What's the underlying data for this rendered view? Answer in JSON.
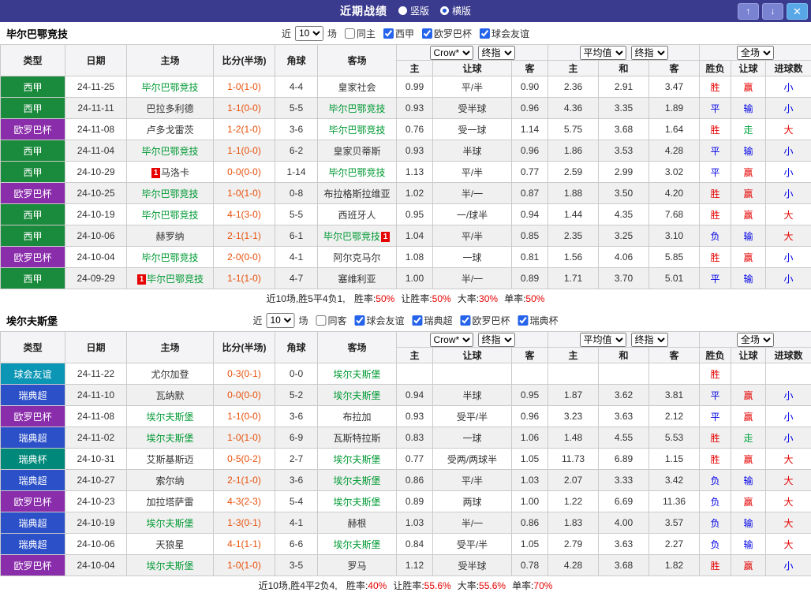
{
  "topbar": {
    "title": "近期战绩",
    "radios": [
      {
        "label": "竖版",
        "selected": false
      },
      {
        "label": "横版",
        "selected": true
      }
    ],
    "up_icon": "↑",
    "down_icon": "↓",
    "close_icon": "✕"
  },
  "colors": {
    "topbar_bg": "#3a3a8e",
    "focus_team": "#009933",
    "score": "#e8500a",
    "summary_value": "#e60000",
    "league_colors": {
      "西甲": "#1a8a3c",
      "欧罗巴杯": "#8a2dab",
      "球会友谊": "#0a96b4",
      "瑞典超": "#2b50c8",
      "瑞典杯": "#00897b"
    },
    "result_colors": {
      "胜": "#e60000",
      "平": "#0000e6",
      "负": "#0000e6",
      "赢": "#e60000",
      "输": "#0000e6",
      "走": "#00a33e",
      "大": "#e60000",
      "小": "#0000e6"
    }
  },
  "header": {
    "main_cols": [
      "类型",
      "日期",
      "主场",
      "比分(半场)",
      "角球",
      "客场"
    ],
    "select_groups": [
      [
        {
          "name": "bookmaker-select",
          "label": "Crow*"
        },
        {
          "name": "odds-time-select",
          "label": "终指"
        }
      ],
      [
        {
          "name": "average-select",
          "label": "平均值"
        },
        {
          "name": "avg-odds-time-select",
          "label": "终指"
        }
      ],
      [
        {
          "name": "match-scope-select",
          "label": "全场"
        }
      ]
    ],
    "sub_cols": [
      "主",
      "让球",
      "客",
      "主",
      "和",
      "客",
      "胜负",
      "让球",
      "进球数"
    ]
  },
  "tables": [
    {
      "team": "毕尔巴鄂竞技",
      "filter": {
        "near_label": "近",
        "count": "10",
        "games_label": "场",
        "same": {
          "label": "同主",
          "checked": false
        },
        "leagues": [
          {
            "label": "西甲",
            "checked": true
          },
          {
            "label": "欧罗巴杯",
            "checked": true
          },
          {
            "label": "球会友谊",
            "checked": true
          }
        ]
      },
      "rows": [
        {
          "type": "西甲",
          "date": "24-11-25",
          "home": {
            "name": "毕尔巴鄂竞技",
            "focus": true
          },
          "score": "1-0(1-0)",
          "corner": "4-4",
          "away": {
            "name": "皇家社会"
          },
          "odds": [
            "0.99",
            "平/半",
            "0.90"
          ],
          "avg": [
            "2.36",
            "2.91",
            "3.47"
          ],
          "res": [
            "胜",
            "赢",
            "小"
          ]
        },
        {
          "type": "西甲",
          "date": "24-11-11",
          "home": {
            "name": "巴拉多利德"
          },
          "score": "1-1(0-0)",
          "corner": "5-5",
          "away": {
            "name": "毕尔巴鄂竞技",
            "focus": true
          },
          "odds": [
            "0.93",
            "受半球",
            "0.96"
          ],
          "avg": [
            "4.36",
            "3.35",
            "1.89"
          ],
          "res": [
            "平",
            "输",
            "小"
          ]
        },
        {
          "type": "欧罗巴杯",
          "date": "24-11-08",
          "home": {
            "name": "卢多戈雷茨"
          },
          "score": "1-2(1-0)",
          "corner": "3-6",
          "away": {
            "name": "毕尔巴鄂竞技",
            "focus": true
          },
          "odds": [
            "0.76",
            "受一球",
            "1.14"
          ],
          "avg": [
            "5.75",
            "3.68",
            "1.64"
          ],
          "res": [
            "胜",
            "走",
            "大"
          ]
        },
        {
          "type": "西甲",
          "date": "24-11-04",
          "home": {
            "name": "毕尔巴鄂竞技",
            "focus": true
          },
          "score": "1-1(0-0)",
          "corner": "6-2",
          "away": {
            "name": "皇家贝蒂斯"
          },
          "odds": [
            "0.93",
            "半球",
            "0.96"
          ],
          "avg": [
            "1.86",
            "3.53",
            "4.28"
          ],
          "res": [
            "平",
            "输",
            "小"
          ]
        },
        {
          "type": "西甲",
          "date": "24-10-29",
          "home": {
            "name": "马洛卡",
            "card_before": true
          },
          "score": "0-0(0-0)",
          "corner": "1-14",
          "away": {
            "name": "毕尔巴鄂竞技",
            "focus": true
          },
          "odds": [
            "1.13",
            "平/半",
            "0.77"
          ],
          "avg": [
            "2.59",
            "2.99",
            "3.02"
          ],
          "res": [
            "平",
            "赢",
            "小"
          ]
        },
        {
          "type": "欧罗巴杯",
          "date": "24-10-25",
          "home": {
            "name": "毕尔巴鄂竞技",
            "focus": true
          },
          "score": "1-0(1-0)",
          "corner": "0-8",
          "away": {
            "name": "布拉格斯拉维亚"
          },
          "odds": [
            "1.02",
            "半/一",
            "0.87"
          ],
          "avg": [
            "1.88",
            "3.50",
            "4.20"
          ],
          "res": [
            "胜",
            "赢",
            "小"
          ]
        },
        {
          "type": "西甲",
          "date": "24-10-19",
          "home": {
            "name": "毕尔巴鄂竞技",
            "focus": true
          },
          "score": "4-1(3-0)",
          "corner": "5-5",
          "away": {
            "name": "西班牙人"
          },
          "odds": [
            "0.95",
            "一/球半",
            "0.94"
          ],
          "avg": [
            "1.44",
            "4.35",
            "7.68"
          ],
          "res": [
            "胜",
            "赢",
            "大"
          ]
        },
        {
          "type": "西甲",
          "date": "24-10-06",
          "home": {
            "name": "赫罗纳"
          },
          "score": "2-1(1-1)",
          "corner": "6-1",
          "away": {
            "name": "毕尔巴鄂竞技",
            "focus": true,
            "card_after": true
          },
          "odds": [
            "1.04",
            "平/半",
            "0.85"
          ],
          "avg": [
            "2.35",
            "3.25",
            "3.10"
          ],
          "res": [
            "负",
            "输",
            "大"
          ]
        },
        {
          "type": "欧罗巴杯",
          "date": "24-10-04",
          "home": {
            "name": "毕尔巴鄂竞技",
            "focus": true
          },
          "score": "2-0(0-0)",
          "corner": "4-1",
          "away": {
            "name": "阿尔克马尔"
          },
          "odds": [
            "1.08",
            "一球",
            "0.81"
          ],
          "avg": [
            "1.56",
            "4.06",
            "5.85"
          ],
          "res": [
            "胜",
            "赢",
            "小"
          ]
        },
        {
          "type": "西甲",
          "date": "24-09-29",
          "home": {
            "name": "毕尔巴鄂竞技",
            "focus": true,
            "card_before": true
          },
          "score": "1-1(1-0)",
          "corner": "4-7",
          "away": {
            "name": "塞维利亚"
          },
          "odds": [
            "1.00",
            "半/一",
            "0.89"
          ],
          "avg": [
            "1.71",
            "3.70",
            "5.01"
          ],
          "res": [
            "平",
            "输",
            "小"
          ]
        }
      ],
      "summary": {
        "prefix": "近10场,胜5平4负1,",
        "stats": [
          {
            "label": "胜率:",
            "value": "50%"
          },
          {
            "label": "让胜率:",
            "value": "50%"
          },
          {
            "label": "大率:",
            "value": "30%"
          },
          {
            "label": "单率:",
            "value": "50%"
          }
        ]
      }
    },
    {
      "team": "埃尔夫斯堡",
      "filter": {
        "near_label": "近",
        "count": "10",
        "games_label": "场",
        "same": {
          "label": "同客",
          "checked": false
        },
        "leagues": [
          {
            "label": "球会友谊",
            "checked": true
          },
          {
            "label": "瑞典超",
            "checked": true
          },
          {
            "label": "欧罗巴杯",
            "checked": true
          },
          {
            "label": "瑞典杯",
            "checked": true
          }
        ]
      },
      "rows": [
        {
          "type": "球会友谊",
          "date": "24-11-22",
          "home": {
            "name": "尤尔加登"
          },
          "score": "0-3(0-1)",
          "corner": "0-0",
          "away": {
            "name": "埃尔夫斯堡",
            "focus": true
          },
          "odds": [
            "",
            "",
            ""
          ],
          "avg": [
            "",
            "",
            ""
          ],
          "res": [
            "胜",
            "",
            ""
          ]
        },
        {
          "type": "瑞典超",
          "date": "24-11-10",
          "home": {
            "name": "瓦纳默"
          },
          "score": "0-0(0-0)",
          "corner": "5-2",
          "away": {
            "name": "埃尔夫斯堡",
            "focus": true
          },
          "odds": [
            "0.94",
            "半球",
            "0.95"
          ],
          "avg": [
            "1.87",
            "3.62",
            "3.81"
          ],
          "res": [
            "平",
            "赢",
            "小"
          ]
        },
        {
          "type": "欧罗巴杯",
          "date": "24-11-08",
          "home": {
            "name": "埃尔夫斯堡",
            "focus": true
          },
          "score": "1-1(0-0)",
          "corner": "3-6",
          "away": {
            "name": "布拉加"
          },
          "odds": [
            "0.93",
            "受平/半",
            "0.96"
          ],
          "avg": [
            "3.23",
            "3.63",
            "2.12"
          ],
          "res": [
            "平",
            "赢",
            "小"
          ]
        },
        {
          "type": "瑞典超",
          "date": "24-11-02",
          "home": {
            "name": "埃尔夫斯堡",
            "focus": true
          },
          "score": "1-0(1-0)",
          "corner": "6-9",
          "away": {
            "name": "瓦斯特拉斯"
          },
          "odds": [
            "0.83",
            "一球",
            "1.06"
          ],
          "avg": [
            "1.48",
            "4.55",
            "5.53"
          ],
          "res": [
            "胜",
            "走",
            "小"
          ]
        },
        {
          "type": "瑞典杯",
          "date": "24-10-31",
          "home": {
            "name": "艾斯基斯迈"
          },
          "score": "0-5(0-2)",
          "corner": "2-7",
          "away": {
            "name": "埃尔夫斯堡",
            "focus": true
          },
          "odds": [
            "0.77",
            "受两/两球半",
            "1.05"
          ],
          "avg": [
            "11.73",
            "6.89",
            "1.15"
          ],
          "res": [
            "胜",
            "赢",
            "大"
          ]
        },
        {
          "type": "瑞典超",
          "date": "24-10-27",
          "home": {
            "name": "索尔纳"
          },
          "score": "2-1(1-0)",
          "corner": "3-6",
          "away": {
            "name": "埃尔夫斯堡",
            "focus": true
          },
          "odds": [
            "0.86",
            "平/半",
            "1.03"
          ],
          "avg": [
            "2.07",
            "3.33",
            "3.42"
          ],
          "res": [
            "负",
            "输",
            "大"
          ]
        },
        {
          "type": "欧罗巴杯",
          "date": "24-10-23",
          "home": {
            "name": "加拉塔萨雷"
          },
          "score": "4-3(2-3)",
          "corner": "5-4",
          "away": {
            "name": "埃尔夫斯堡",
            "focus": true
          },
          "odds": [
            "0.89",
            "两球",
            "1.00"
          ],
          "avg": [
            "1.22",
            "6.69",
            "11.36"
          ],
          "res": [
            "负",
            "赢",
            "大"
          ]
        },
        {
          "type": "瑞典超",
          "date": "24-10-19",
          "home": {
            "name": "埃尔夫斯堡",
            "focus": true
          },
          "score": "1-3(0-1)",
          "corner": "4-1",
          "away": {
            "name": "赫根"
          },
          "odds": [
            "1.03",
            "半/一",
            "0.86"
          ],
          "avg": [
            "1.83",
            "4.00",
            "3.57"
          ],
          "res": [
            "负",
            "输",
            "大"
          ]
        },
        {
          "type": "瑞典超",
          "date": "24-10-06",
          "home": {
            "name": "天狼星"
          },
          "score": "4-1(1-1)",
          "corner": "6-6",
          "away": {
            "name": "埃尔夫斯堡",
            "focus": true
          },
          "odds": [
            "0.84",
            "受平/半",
            "1.05"
          ],
          "avg": [
            "2.79",
            "3.63",
            "2.27"
          ],
          "res": [
            "负",
            "输",
            "大"
          ]
        },
        {
          "type": "欧罗巴杯",
          "date": "24-10-04",
          "home": {
            "name": "埃尔夫斯堡",
            "focus": true
          },
          "score": "1-0(1-0)",
          "corner": "3-5",
          "away": {
            "name": "罗马"
          },
          "odds": [
            "1.12",
            "受半球",
            "0.78"
          ],
          "avg": [
            "4.28",
            "3.68",
            "1.82"
          ],
          "res": [
            "胜",
            "赢",
            "小"
          ]
        }
      ],
      "summary": {
        "prefix": "近10场,胜4平2负4,",
        "stats": [
          {
            "label": "胜率:",
            "value": "40%"
          },
          {
            "label": "让胜率:",
            "value": "55.6%"
          },
          {
            "label": "大率:",
            "value": "55.6%"
          },
          {
            "label": "单率:",
            "value": "70%"
          }
        ]
      }
    }
  ]
}
